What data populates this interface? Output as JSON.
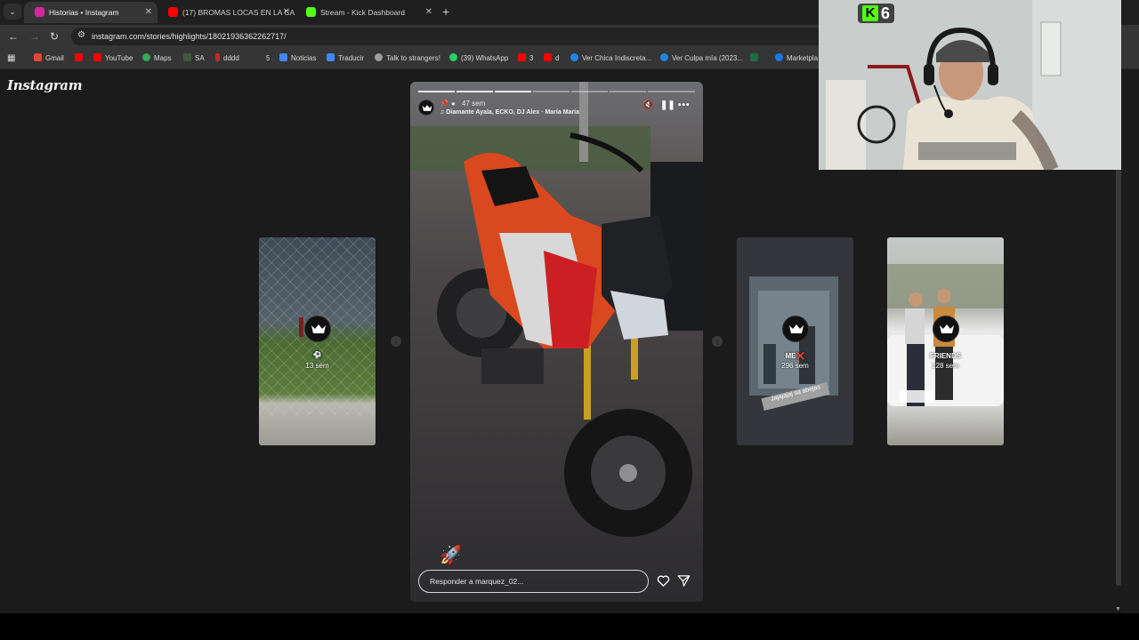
{
  "browser": {
    "tabs": [
      {
        "title": "Historias • Instagram",
        "active": true,
        "icon": "instagram-icon",
        "color": "#d6249f"
      },
      {
        "title": "(17) BROMAS LOCAS EN LA CA",
        "active": false,
        "icon": "youtube-icon",
        "color": "#ff0000"
      },
      {
        "title": "Stream - Kick Dashboard",
        "active": false,
        "icon": "kick-icon",
        "color": "#53fc18"
      }
    ],
    "url": "instagram.com/stories/highlights/18021936362262717/",
    "bookmarks": [
      {
        "label": "Gmail",
        "icon": "gmail-icon",
        "color": "#ea4335"
      },
      {
        "label": "",
        "icon": "youtube-icon",
        "color": "#ff0000"
      },
      {
        "label": "YouTube",
        "icon": "youtube-icon",
        "color": "#ff0000"
      },
      {
        "label": "Maps",
        "icon": "maps-icon",
        "color": "#34a853"
      },
      {
        "label": "SA",
        "icon": "globe-icon",
        "color": "#3c5a3c"
      },
      {
        "label": "dddd",
        "icon": "bookmark-icon",
        "color": "#c62828"
      },
      {
        "label": "5",
        "icon": "bookmark-icon",
        "color": "#353535"
      },
      {
        "label": "Noticias",
        "icon": "news-icon",
        "color": "#4285f4"
      },
      {
        "label": "Traducir",
        "icon": "translate-icon",
        "color": "#4285f4"
      },
      {
        "label": "Talk to strangers!",
        "icon": "chat-icon",
        "color": "#9e9e9e"
      },
      {
        "label": "(39) WhatsApp",
        "icon": "whatsapp-icon",
        "color": "#25d366"
      },
      {
        "label": "3",
        "icon": "youtube-icon",
        "color": "#ff0000"
      },
      {
        "label": "d",
        "icon": "youtube-icon",
        "color": "#ff0000"
      },
      {
        "label": "Ver Chica Indiscreta...",
        "icon": "globe-icon",
        "color": "#1e88e5"
      },
      {
        "label": "Ver Culpa mía (2023...",
        "icon": "globe-icon",
        "color": "#1e88e5"
      },
      {
        "label": "",
        "icon": "excel-icon",
        "color": "#1d6f42"
      },
      {
        "label": "Marketpla",
        "icon": "facebook-icon",
        "color": "#1877f2"
      }
    ]
  },
  "instagram": {
    "logo": "Instagram",
    "left_card": {
      "time": "13 sem",
      "emoji": "⚽"
    },
    "right_card_1": {
      "label": "ME",
      "label_emoji": "❌",
      "time": "296 sem",
      "sticker": "Jajajajaj sa abejas"
    },
    "right_card_2": {
      "label": "FRIENDS",
      "time": "228 sem"
    },
    "story": {
      "time": "47 sem",
      "song": "Diamante Ayala, ECKO, DJ Alex · María María",
      "reply_placeholder": "Responder a marquez_02...",
      "emoji": "🚀",
      "progress_segments": 7,
      "progress_done": 3
    }
  },
  "webcam": {
    "kick_viewers": "6"
  }
}
